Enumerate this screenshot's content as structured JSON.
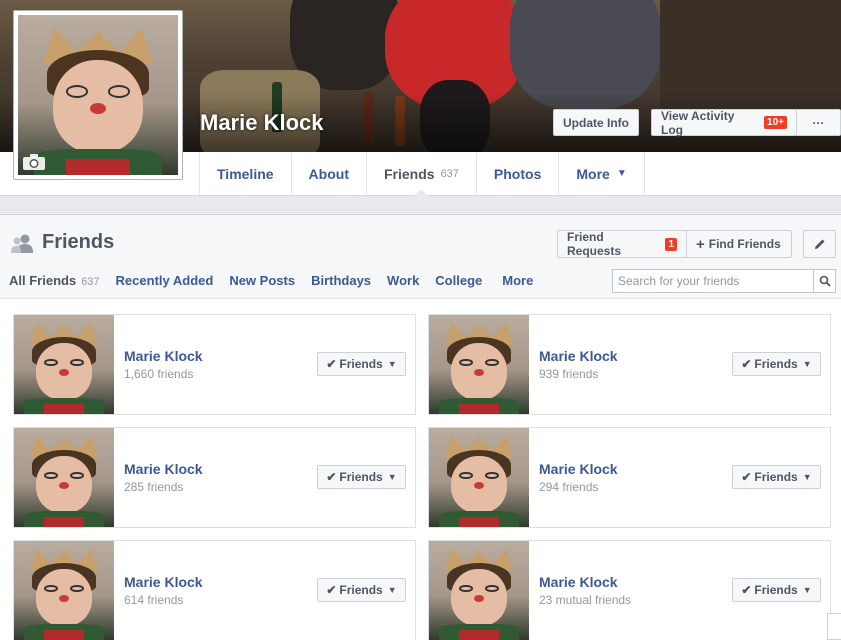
{
  "profile": {
    "name": "Marie Klock",
    "update_info": "Update Info",
    "activity_log": "View Activity Log",
    "activity_badge": "10+",
    "more_dots": "···"
  },
  "nav": {
    "tabs": [
      {
        "label": "Timeline"
      },
      {
        "label": "About"
      },
      {
        "label": "Friends",
        "count": "637"
      },
      {
        "label": "Photos"
      },
      {
        "label": "More"
      }
    ]
  },
  "friends": {
    "title": "Friends",
    "friend_requests": "Friend Requests",
    "requests_badge": "1",
    "find_friends": "Find Friends",
    "filters": [
      {
        "label": "All Friends",
        "count": "637"
      },
      {
        "label": "Recently Added"
      },
      {
        "label": "New Posts"
      },
      {
        "label": "Birthdays"
      },
      {
        "label": "Work"
      },
      {
        "label": "College"
      },
      {
        "label": "More"
      }
    ],
    "search_placeholder": "Search for your friends",
    "button_label": "Friends",
    "cards": [
      {
        "name": "Marie Klock",
        "count": "1,660 friends"
      },
      {
        "name": "Marie Klock",
        "count": "939 friends"
      },
      {
        "name": "Marie Klock",
        "count": "285 friends"
      },
      {
        "name": "Marie Klock",
        "count": "294 friends"
      },
      {
        "name": "Marie Klock",
        "count": "614 friends"
      },
      {
        "name": "Marie Klock",
        "count": "23 mutual friends"
      }
    ]
  },
  "colors": {
    "link": "#3b5998",
    "badge": "#f03d25",
    "page_bg": "#e9eaed"
  }
}
